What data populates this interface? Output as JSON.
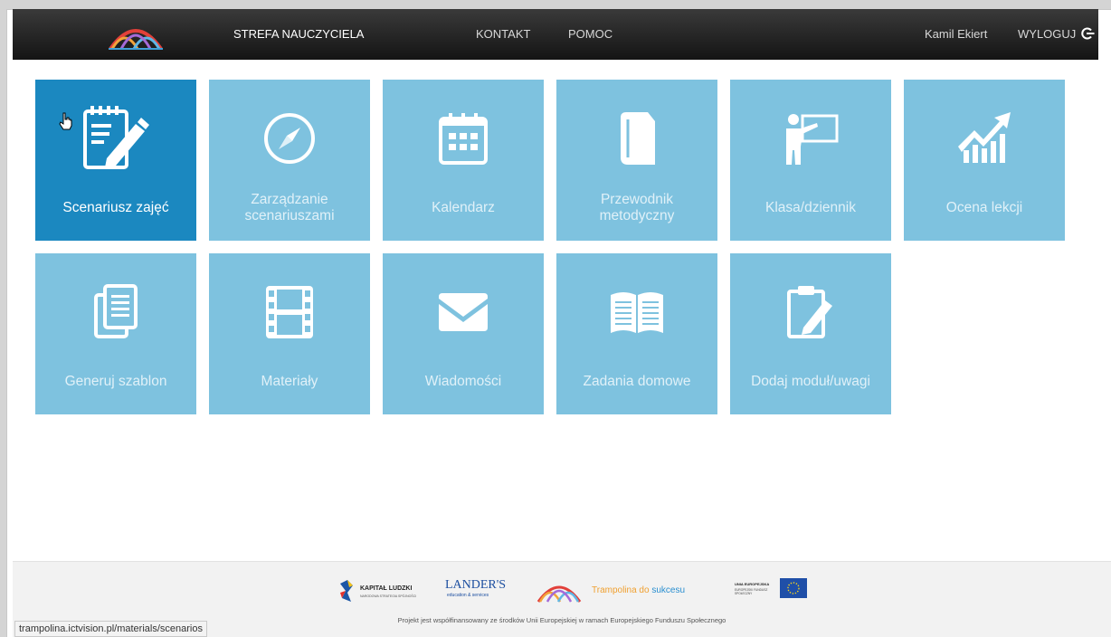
{
  "header": {
    "brand_label": "STREFA NAUCZYCIELA",
    "nav": [
      "KONTAKT",
      "POMOC"
    ],
    "user_name": "Kamil Ekiert",
    "logout_label": "WYLOGUJ"
  },
  "tiles": [
    {
      "label": "Scenariusz zajęć",
      "icon": "lesson-plan-icon",
      "active": true
    },
    {
      "label": "Zarządzanie scenariuszami",
      "icon": "compass-icon",
      "active": false
    },
    {
      "label": "Kalendarz",
      "icon": "calendar-icon",
      "active": false
    },
    {
      "label": "Przewodnik metodyczny",
      "icon": "book-icon",
      "active": false
    },
    {
      "label": "Klasa/dziennik",
      "icon": "teacher-board-icon",
      "active": false
    },
    {
      "label": "Ocena lekcji",
      "icon": "growth-chart-icon",
      "active": false
    },
    {
      "label": "Generuj szablon",
      "icon": "documents-icon",
      "active": false
    },
    {
      "label": "Materiały",
      "icon": "film-icon",
      "active": false
    },
    {
      "label": "Wiadomości",
      "icon": "envelope-icon",
      "active": false
    },
    {
      "label": "Zadania domowe",
      "icon": "open-book-icon",
      "active": false
    },
    {
      "label": "Dodaj moduł/uwagi",
      "icon": "clipboard-edit-icon",
      "active": false
    }
  ],
  "footer": {
    "kl_title": "KAPITAŁ LUDZKI",
    "kl_subtitle": "NARODOWA STRATEGIA SPÓJNOŚCI",
    "landers": "LANDER'S",
    "landers_sub": "education & services",
    "tramp_a": "Trampolina do",
    "tramp_b": "sukcesu",
    "ue_text": "UNIA EUROPEJSKA",
    "ue_sub": "EUROPEJSKI FUNDUSZ SPOŁECZNY",
    "note": "Projekt jest współfinansowany ze środków Unii Europejskiej w ramach Europejskiego Funduszu Społecznego"
  },
  "status_url": "trampolina.ictvision.pl/materials/scenarios",
  "colors": {
    "tile": "#7ec2df",
    "tile_active": "#1b88c0",
    "topbar": "#1e1e1e",
    "accent_orange": "#f0a030",
    "accent_blue": "#2a8fd0"
  }
}
